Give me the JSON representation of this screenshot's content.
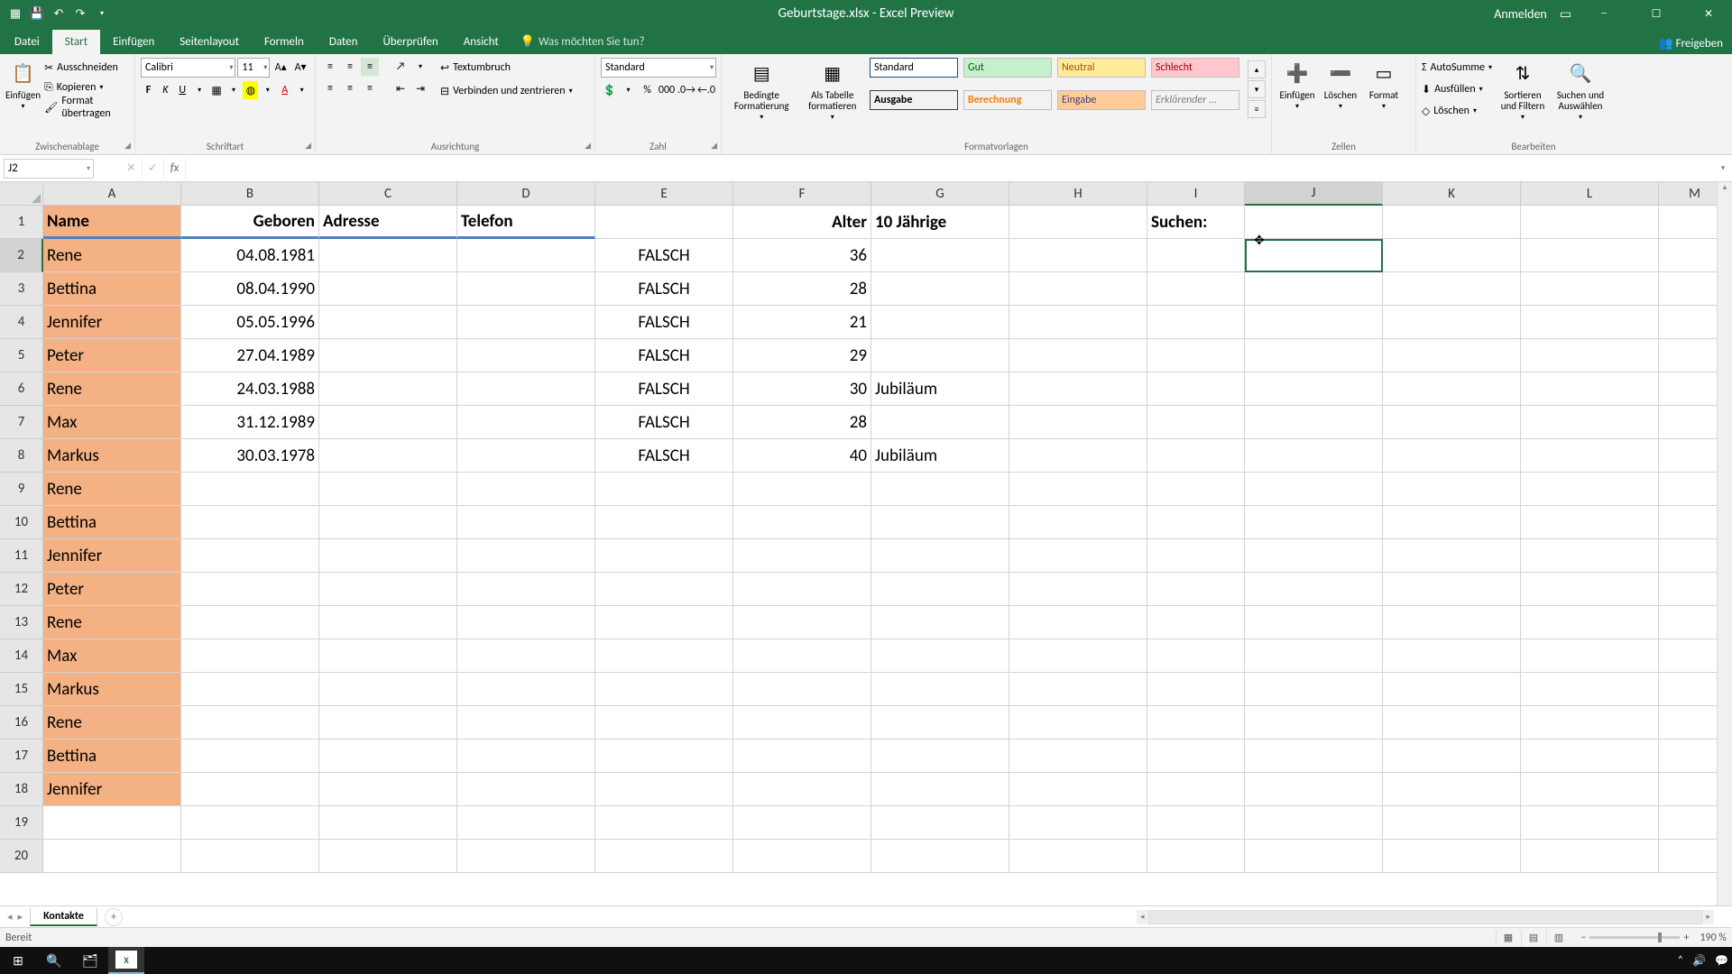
{
  "title": "Geburtstage.xlsx - Excel Preview",
  "title_right": {
    "signin": "Anmelden"
  },
  "tabs": {
    "file": "Datei",
    "start": "Start",
    "einfugen": "Einfügen",
    "layout": "Seitenlayout",
    "formeln": "Formeln",
    "daten": "Daten",
    "uberprufen": "Überprüfen",
    "ansicht": "Ansicht",
    "tellme": "Was möchten Sie tun?",
    "freigeben": "Freigeben"
  },
  "ribbon": {
    "clipboard": {
      "paste": "Einfügen",
      "cut": "Ausschneiden",
      "copy": "Kopieren",
      "format": "Format übertragen",
      "label": "Zwischenablage"
    },
    "font": {
      "name": "Calibri",
      "size": "11",
      "label": "Schriftart"
    },
    "align": {
      "wrap": "Textumbruch",
      "merge": "Verbinden und zentrieren",
      "label": "Ausrichtung"
    },
    "number": {
      "format": "Standard",
      "label": "Zahl"
    },
    "styles": {
      "cond": "Bedingte Formatierung",
      "table": "Als Tabelle formatieren",
      "s1": "Standard",
      "s2": "Gut",
      "s3": "Neutral",
      "s4": "Schlecht",
      "s5": "Ausgabe",
      "s6": "Berechnung",
      "s7": "Eingabe",
      "s8": "Erklärender ...",
      "label": "Formatvorlagen"
    },
    "cells": {
      "insert": "Einfügen",
      "delete": "Löschen",
      "format": "Format",
      "label": "Zellen"
    },
    "editing": {
      "sum": "AutoSumme",
      "fill": "Ausfüllen",
      "clear": "Löschen",
      "sort": "Sortieren und Filtern",
      "find": "Suchen und Auswählen",
      "label": "Bearbeiten"
    }
  },
  "name_box": "J2",
  "columns": [
    "A",
    "B",
    "C",
    "D",
    "E",
    "F",
    "G",
    "H",
    "I",
    "J",
    "K",
    "L",
    "M"
  ],
  "row_count": 20,
  "selected_cell": {
    "row": 2,
    "col": "J"
  },
  "headers": {
    "A": "Name",
    "B": "Geboren",
    "C": "Adresse",
    "D": "Telefon",
    "F": "Alter",
    "G": "10 Jährige",
    "I": "Suchen:"
  },
  "data_rows": [
    {
      "A": "Rene",
      "B": "04.08.1981",
      "E": "FALSCH",
      "F": "36"
    },
    {
      "A": "Bettina",
      "B": "08.04.1990",
      "E": "FALSCH",
      "F": "28"
    },
    {
      "A": "Jennifer",
      "B": "05.05.1996",
      "E": "FALSCH",
      "F": "21"
    },
    {
      "A": "Peter",
      "B": "27.04.1989",
      "E": "FALSCH",
      "F": "29"
    },
    {
      "A": "Rene",
      "B": "24.03.1988",
      "E": "FALSCH",
      "F": "30",
      "G": "Jubiläum"
    },
    {
      "A": "Max",
      "B": "31.12.1989",
      "E": "FALSCH",
      "F": "28"
    },
    {
      "A": "Markus",
      "B": "30.03.1978",
      "E": "FALSCH",
      "F": "40",
      "G": "Jubiläum"
    },
    {
      "A": "Rene"
    },
    {
      "A": "Bettina"
    },
    {
      "A": "Jennifer"
    },
    {
      "A": "Peter"
    },
    {
      "A": "Rene"
    },
    {
      "A": "Max"
    },
    {
      "A": "Markus"
    },
    {
      "A": "Rene"
    },
    {
      "A": "Bettina"
    },
    {
      "A": "Jennifer"
    }
  ],
  "sheet_tab": "Kontakte",
  "status": "Bereit",
  "zoom": "190 %"
}
